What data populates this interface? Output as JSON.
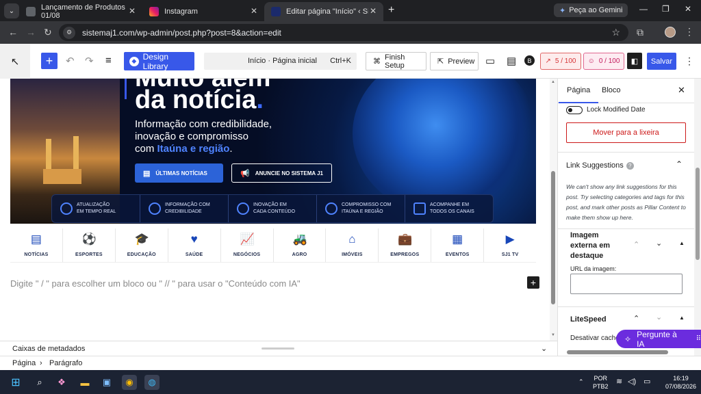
{
  "browser": {
    "tabs": [
      {
        "title": "Lançamento de Produtos 01/08",
        "active": false
      },
      {
        "title": "Instagram",
        "active": false
      },
      {
        "title": "Editar página \"Início\" ‹ Sistema",
        "active": true
      }
    ],
    "gemini_label": "Peça ao Gemini",
    "url": "sistemaj1.com/wp-admin/post.php?post=8&action=edit"
  },
  "editor_header": {
    "design_library": "Design Library",
    "doc_title": "Início · Página inicial",
    "doc_shortcut": "Ctrl+K",
    "finish_setup": "Finish Setup",
    "preview": "Preview",
    "seo_score": "5 / 100",
    "readability_score": "0 / 100",
    "save": "Salvar"
  },
  "hero": {
    "headline_top": "Muito além",
    "headline": "da notícia",
    "headline_dot": ".",
    "lead_1": "Informação com credibilidade,",
    "lead_2": "inovação e compromisso",
    "lead_3_prefix": "com ",
    "lead_3_highlight": "Itaúna e região",
    "lead_3_suffix": ".",
    "cta_primary": "ÚLTIMAS NOTÍCIAS",
    "cta_secondary": "ANUNCIE NO SISTEMA J1",
    "features": [
      {
        "line1": "Atualização",
        "line2": "em tempo real"
      },
      {
        "line1": "Informação com",
        "line2": "credibilidade"
      },
      {
        "line1": "Inovação em",
        "line2": "cada conteúdo"
      },
      {
        "line1": "Compromisso com",
        "line2": "Itaúna e região"
      },
      {
        "line1": "Acompanhe em",
        "line2": "todos os canais"
      }
    ]
  },
  "categories": [
    {
      "label": "NOTÍCIAS",
      "icon": "newspaper-icon",
      "glyph": "▤"
    },
    {
      "label": "ESPORTES",
      "icon": "soccer-ball-icon",
      "glyph": "⚽"
    },
    {
      "label": "EDUCAÇÃO",
      "icon": "graduation-cap-icon",
      "glyph": "🎓"
    },
    {
      "label": "SAÚDE",
      "icon": "heart-pulse-icon",
      "glyph": "♥"
    },
    {
      "label": "NEGÓCIOS",
      "icon": "chart-up-icon",
      "glyph": "📈"
    },
    {
      "label": "AGRO",
      "icon": "tractor-icon",
      "glyph": "🚜"
    },
    {
      "label": "IMÓVEIS",
      "icon": "house-icon",
      "glyph": "⌂"
    },
    {
      "label": "EMPREGOS",
      "icon": "briefcase-icon",
      "glyph": "💼"
    },
    {
      "label": "EVENTOS",
      "icon": "calendar-icon",
      "glyph": "▦"
    },
    {
      "label": "SJ1 TV",
      "icon": "tv-icon",
      "glyph": "▶"
    }
  ],
  "block_placeholder": "Digite \" / \" para escolher um bloco ou \" // \" para usar o \"Conteúdo com IA\"",
  "metaboxes_label": "Caixas de metadados",
  "breadcrumb": {
    "first": "Página",
    "separator": "›",
    "second": "Parágrafo"
  },
  "sidebar": {
    "tab_page": "Página",
    "tab_block": "Bloco",
    "lock_modified_date": "Lock Modified Date",
    "move_to_trash": "Mover para a lixeira",
    "link_suggestions_title": "Link Suggestions",
    "link_suggestions_text": "We can't show any link suggestions for this post. Try selecting categories and tags for this post, and mark other posts as Pillar Content to make them show up here.",
    "external_image_title": "Imagem externa em destaque",
    "image_url_label": "URL da imagem:",
    "litespeed_title": "LiteSpeed",
    "disable_cache": "Desativar cache",
    "ai_button": "Pergunte à IA"
  },
  "taskbar": {
    "lang_1": "POR",
    "lang_2": "PTB2",
    "time": "16:19",
    "date": "07/08/2026"
  },
  "colors": {
    "wp_blue": "#3858e9",
    "trash_red": "#cc1818",
    "ai_purple": "#6b2cde",
    "hero_navy": "#050d25"
  }
}
